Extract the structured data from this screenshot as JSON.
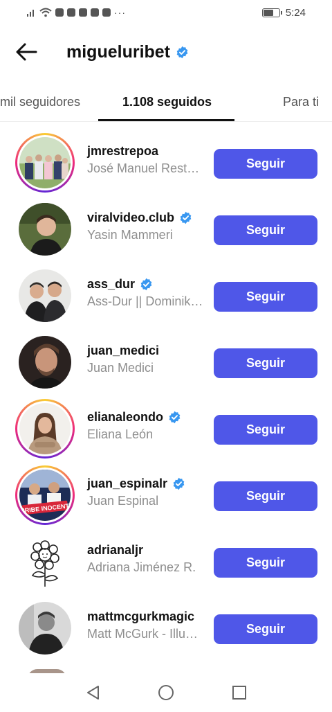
{
  "status_bar": {
    "time": "5:24",
    "overflow_indicator": "···"
  },
  "header": {
    "title": "migueluribet",
    "back_icon": "arrow-left-icon",
    "verified": true
  },
  "tabs": [
    {
      "label": "mil seguidores",
      "active": false
    },
    {
      "label": "1.108 seguidos",
      "active": true
    },
    {
      "label": "Para ti",
      "active": false
    }
  ],
  "accounts": [
    {
      "username": "jmrestrepoa",
      "full_name": "José Manuel Restrepo Abondano",
      "display_name": "José Manuel Rest…",
      "verified": false,
      "story": true,
      "button": "Seguir"
    },
    {
      "username": "viralvideo.club",
      "full_name": "Yasin Mammeri",
      "display_name": "Yasin Mammeri",
      "verified": true,
      "story": false,
      "button": "Seguir"
    },
    {
      "username": "ass_dur",
      "full_name": "Ass-Dur || Dominik...",
      "display_name": "Ass-Dur || Dominik…",
      "verified": true,
      "story": false,
      "button": "Seguir"
    },
    {
      "username": "juan_medici",
      "full_name": "Juan Medici",
      "display_name": "Juan Medici",
      "verified": false,
      "story": false,
      "button": "Seguir"
    },
    {
      "username": "elianaleondo",
      "full_name": "Eliana León",
      "display_name": "Eliana León",
      "verified": true,
      "story": true,
      "button": "Seguir"
    },
    {
      "username": "juan_espinalr",
      "full_name": "Juan Espinal",
      "display_name": "Juan Espinal",
      "verified": true,
      "story": true,
      "button": "Seguir"
    },
    {
      "username": "adrianaljr",
      "full_name": "Adriana Jiménez R.",
      "display_name": "Adriana Jiménez R.",
      "verified": false,
      "story": false,
      "button": "Seguir"
    },
    {
      "username": "mattmcgurkmagic",
      "full_name": "Matt McGurk - Illu...",
      "display_name": "Matt McGurk - Illu…",
      "verified": false,
      "story": false,
      "button": "Seguir"
    }
  ],
  "avatar_badge_text": "#URIBE INOCENTE",
  "colors": {
    "accent": "#4f57e8",
    "verified": "#3897f0",
    "secondary_text": "#8e8e8e"
  },
  "nav": {
    "back": "triangle-back-icon",
    "home": "circle-home-icon",
    "recents": "square-recents-icon"
  }
}
